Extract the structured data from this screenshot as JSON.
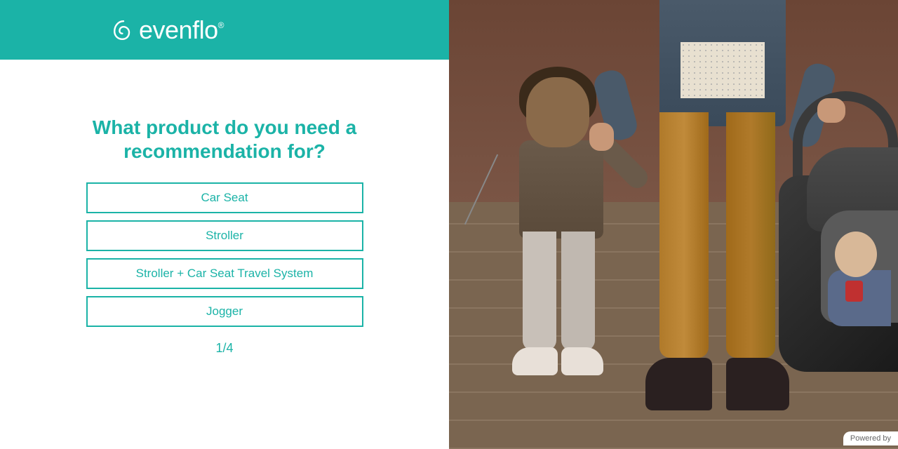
{
  "header": {
    "brand_name": "evenflo"
  },
  "quiz": {
    "question": "What product do you need a recommendation for?",
    "options": [
      "Car Seat",
      "Stroller",
      "Stroller + Car Seat Travel System",
      "Jogger"
    ],
    "progress": "1/4"
  },
  "footer": {
    "powered_by": "Powered by"
  },
  "colors": {
    "primary": "#1bb3a7"
  }
}
